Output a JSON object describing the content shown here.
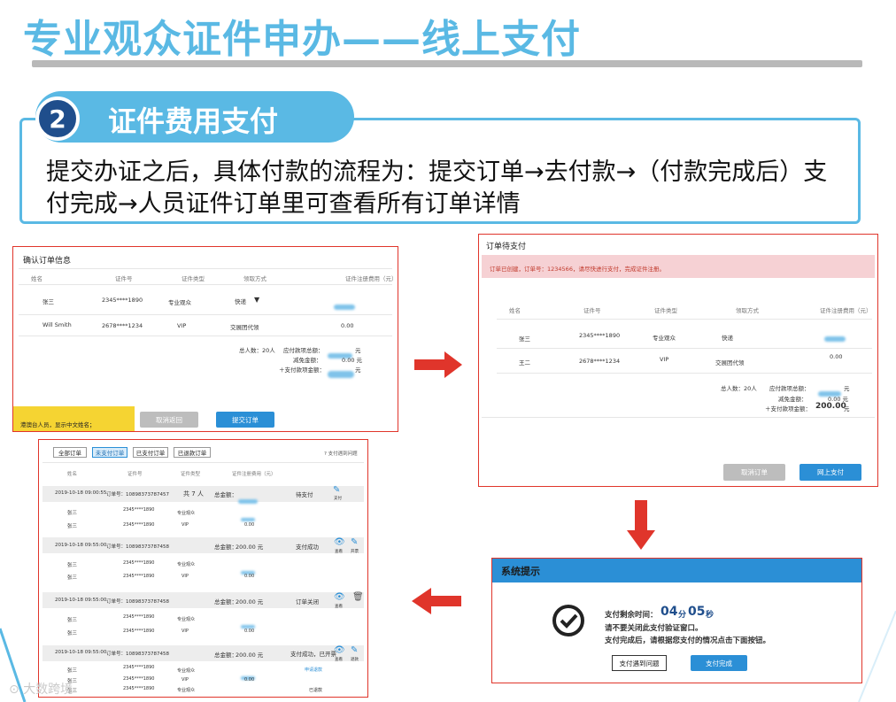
{
  "slide": {
    "title": "专业观众证件申办——线上支付",
    "section_number": "2",
    "section_title": "证件费用支付",
    "description": "提交办证之后，具体付款的流程为：提交订单→去付款→（付款完成后）支付完成→人员证件订单里可查看所有订单详情"
  },
  "confirm": {
    "title": "确认订单信息",
    "columns": [
      "姓名",
      "证件号",
      "证件类型",
      "领取方式",
      "证件注册费用（元）"
    ],
    "rows": [
      {
        "name": "张三",
        "id": "2345****1890",
        "type": "专业观众",
        "pickup": "快递",
        "fee": ""
      },
      {
        "name": "Will Smith",
        "id": "2678****1234",
        "type": "VIP",
        "pickup": "交展团代领",
        "fee": "0.00"
      }
    ],
    "total_people": "总人数：20人",
    "payable_label": "应付款项总额：",
    "discount_label": "减免金额：",
    "discount_value": "0.00 元",
    "pay_label": "＋支付款项金额：",
    "yuan": "元",
    "cancel_btn": "取消返回",
    "submit_btn": "提交订单",
    "note": "港澳台人员，显示中文姓名；"
  },
  "pending": {
    "title": "订单待支付",
    "alert": "订单已创建，订单号：1234566，请尽快进行支付，完成证件注册。",
    "columns": [
      "姓名",
      "证件号",
      "证件类型",
      "领取方式",
      "证件注册费用（元）"
    ],
    "rows": [
      {
        "name": "张三",
        "id": "2345****1890",
        "type": "专业观众",
        "pickup": "快递",
        "fee": ""
      },
      {
        "name": "王二",
        "id": "2678****1234",
        "type": "VIP",
        "pickup": "交展团代领",
        "fee": "0.00"
      }
    ],
    "total_people": "总人数：20人",
    "payable_label": "应付款项总额：",
    "discount_label": "减免金额：",
    "discount_value": "0.00 元",
    "pay_label": "＋支付款项金额：",
    "pay_value": "200.00",
    "yuan": "元",
    "cancel_btn": "取消订单",
    "pay_btn": "网上支付"
  },
  "system": {
    "title": "系统提示",
    "time_label": "支付剩余时间：",
    "minutes": "04",
    "min_unit": "分",
    "seconds": "05",
    "sec_unit": "秒",
    "line2": "请不要关闭此支付验证窗口。",
    "line3": "支付完成后，请根据您支付的情况点击下面按钮。",
    "problem_btn": "支付遇到问题",
    "done_btn": "支付完成"
  },
  "orders": {
    "tabs": [
      "全部订单",
      "未支付订单",
      "已支付订单",
      "已退款订单"
    ],
    "active_tab": 1,
    "link": "? 支付遇到问题",
    "columns": [
      "姓名",
      "证件号",
      "证件类型",
      "证件注册费用（元）"
    ],
    "groups": [
      {
        "date": "2019-10-18 09:00:55",
        "order_no": "订单号：10898373787457",
        "people": "共 7 人",
        "total": "总金额：",
        "amount": "",
        "status": "待支付",
        "icon1": "支付",
        "icon2": "",
        "members": [
          {
            "name": "张三",
            "id": "2345****1890",
            "type": "专业观众",
            "fee": "",
            "state": ""
          },
          {
            "name": "张三",
            "id": "2345****1890",
            "type": "VIP",
            "fee": "0.00",
            "state": ""
          }
        ]
      },
      {
        "date": "2019-10-18 09:55:00",
        "order_no": "订单号：10898373787458",
        "people": "",
        "total": "总金额：",
        "amount": "200.00 元",
        "status": "支付成功",
        "icon1": "查看",
        "icon2": "开票",
        "members": [
          {
            "name": "张三",
            "id": "2345****1890",
            "type": "专业观众",
            "fee": "",
            "state": ""
          },
          {
            "name": "张三",
            "id": "2345****1890",
            "type": "VIP",
            "fee": "0.00",
            "state": ""
          }
        ]
      },
      {
        "date": "2019-10-18 09:55:00",
        "order_no": "订单号：10898373787458",
        "people": "",
        "total": "总金额：",
        "amount": "200.00 元",
        "status": "订单关闭",
        "icon1": "查看",
        "icon2": "",
        "members": [
          {
            "name": "张三",
            "id": "2345****1890",
            "type": "专业观众",
            "fee": "",
            "state": ""
          },
          {
            "name": "张三",
            "id": "2345****1890",
            "type": "VIP",
            "fee": "0.00",
            "state": ""
          }
        ]
      },
      {
        "date": "2019-10-18 09:55:00",
        "order_no": "订单号：10898373787458",
        "people": "",
        "total": "总金额：",
        "amount": "200.00 元",
        "status": "支付成功，已开票",
        "icon1": "查看",
        "icon2": "退款",
        "members": [
          {
            "name": "张三",
            "id": "2345****1890",
            "type": "专业观众",
            "fee": "",
            "state": "申请退款"
          },
          {
            "name": "张三",
            "id": "2345****1890",
            "type": "VIP",
            "fee": "0.00",
            "state": ""
          },
          {
            "name": "张三",
            "id": "2345****1890",
            "type": "专业观众",
            "fee": "",
            "state": "已退款"
          }
        ]
      }
    ]
  },
  "watermark": "大数跨境",
  "colors": {
    "title": "#5ab9e4",
    "panel_border": "#e0352b",
    "arrow": "#e0352b",
    "button": "#2b8fd6",
    "alert_bg": "#f6d1d4"
  }
}
